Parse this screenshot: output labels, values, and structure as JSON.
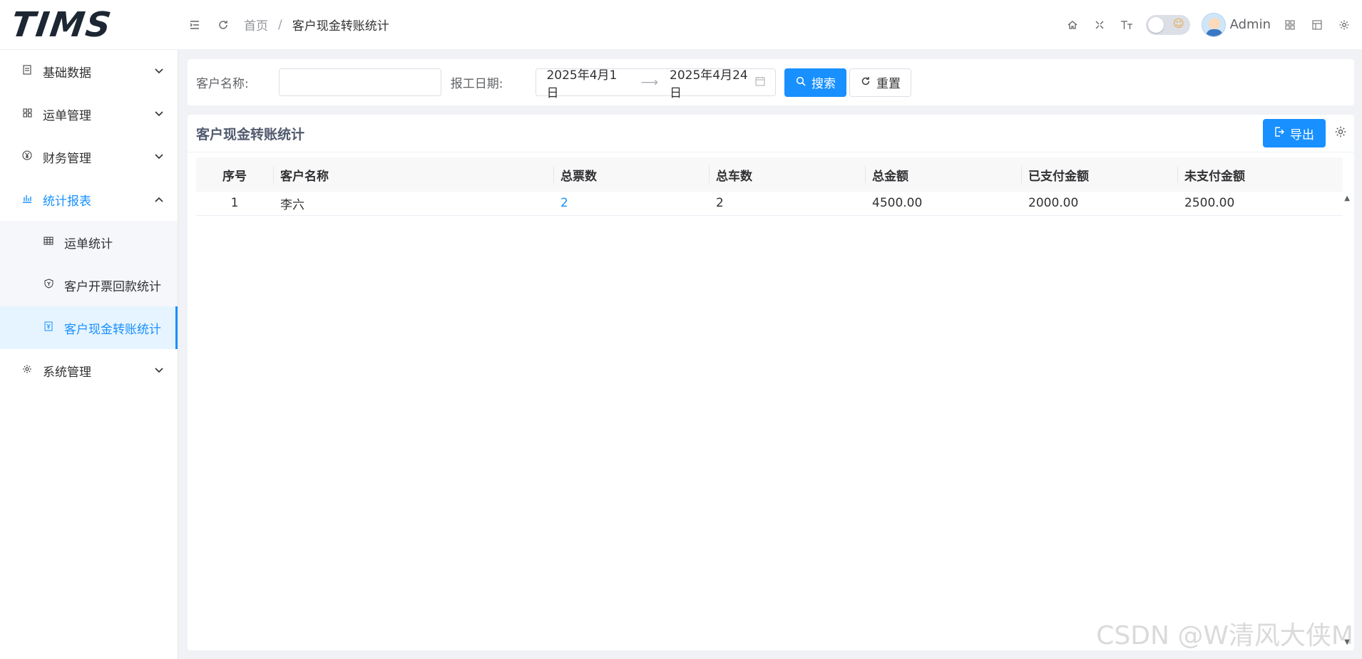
{
  "header": {
    "logo_text": "TIMS",
    "breadcrumb": {
      "home": "首页",
      "separator": "/",
      "current": "客户现金转账统计"
    },
    "icons": [
      "menu-fold-icon",
      "refresh-icon",
      "home-icon",
      "fullscreen-icon",
      "font-size-icon",
      "theme-toggle",
      "grid-icon",
      "layout-icon",
      "gear-icon"
    ],
    "user": {
      "name": "Admin"
    }
  },
  "sidebar": {
    "items": [
      {
        "label": "基础数据",
        "icon": "document-icon"
      },
      {
        "label": "运单管理",
        "icon": "grid-icon"
      },
      {
        "label": "财务管理",
        "icon": "yen-icon"
      },
      {
        "label": "统计报表",
        "icon": "chart-icon"
      },
      {
        "label": "系统管理",
        "icon": "gear-icon"
      }
    ],
    "report_sub": [
      {
        "label": "运单统计",
        "icon": "table-icon"
      },
      {
        "label": "客户开票回款统计",
        "icon": "shield-icon"
      },
      {
        "label": "客户现金转账统计",
        "icon": "receipt-icon"
      }
    ]
  },
  "search": {
    "customer_label": "客户名称:",
    "customer_value": "",
    "date_label": "报工日期:",
    "date_start": "2025年4月1日",
    "date_end": "2025年4月24日",
    "search_button": "搜索",
    "reset_button": "重置"
  },
  "table_card": {
    "title": "客户现金转账统计",
    "export_button": "导出",
    "columns": [
      "序号",
      "客户名称",
      "总票数",
      "总车数",
      "总金额",
      "已支付金额",
      "未支付金额"
    ],
    "rows": [
      {
        "index": "1",
        "customer": "李六",
        "tickets": "2",
        "vehicles": "2",
        "total": "4500.00",
        "paid": "2000.00",
        "unpaid": "2500.00"
      }
    ]
  },
  "watermark": "CSDN @W清风大侠M",
  "colors": {
    "primary": "#1890ff",
    "sidebar_active_bg": "#e6f4ff",
    "logo_accent": "#16b3c0"
  }
}
